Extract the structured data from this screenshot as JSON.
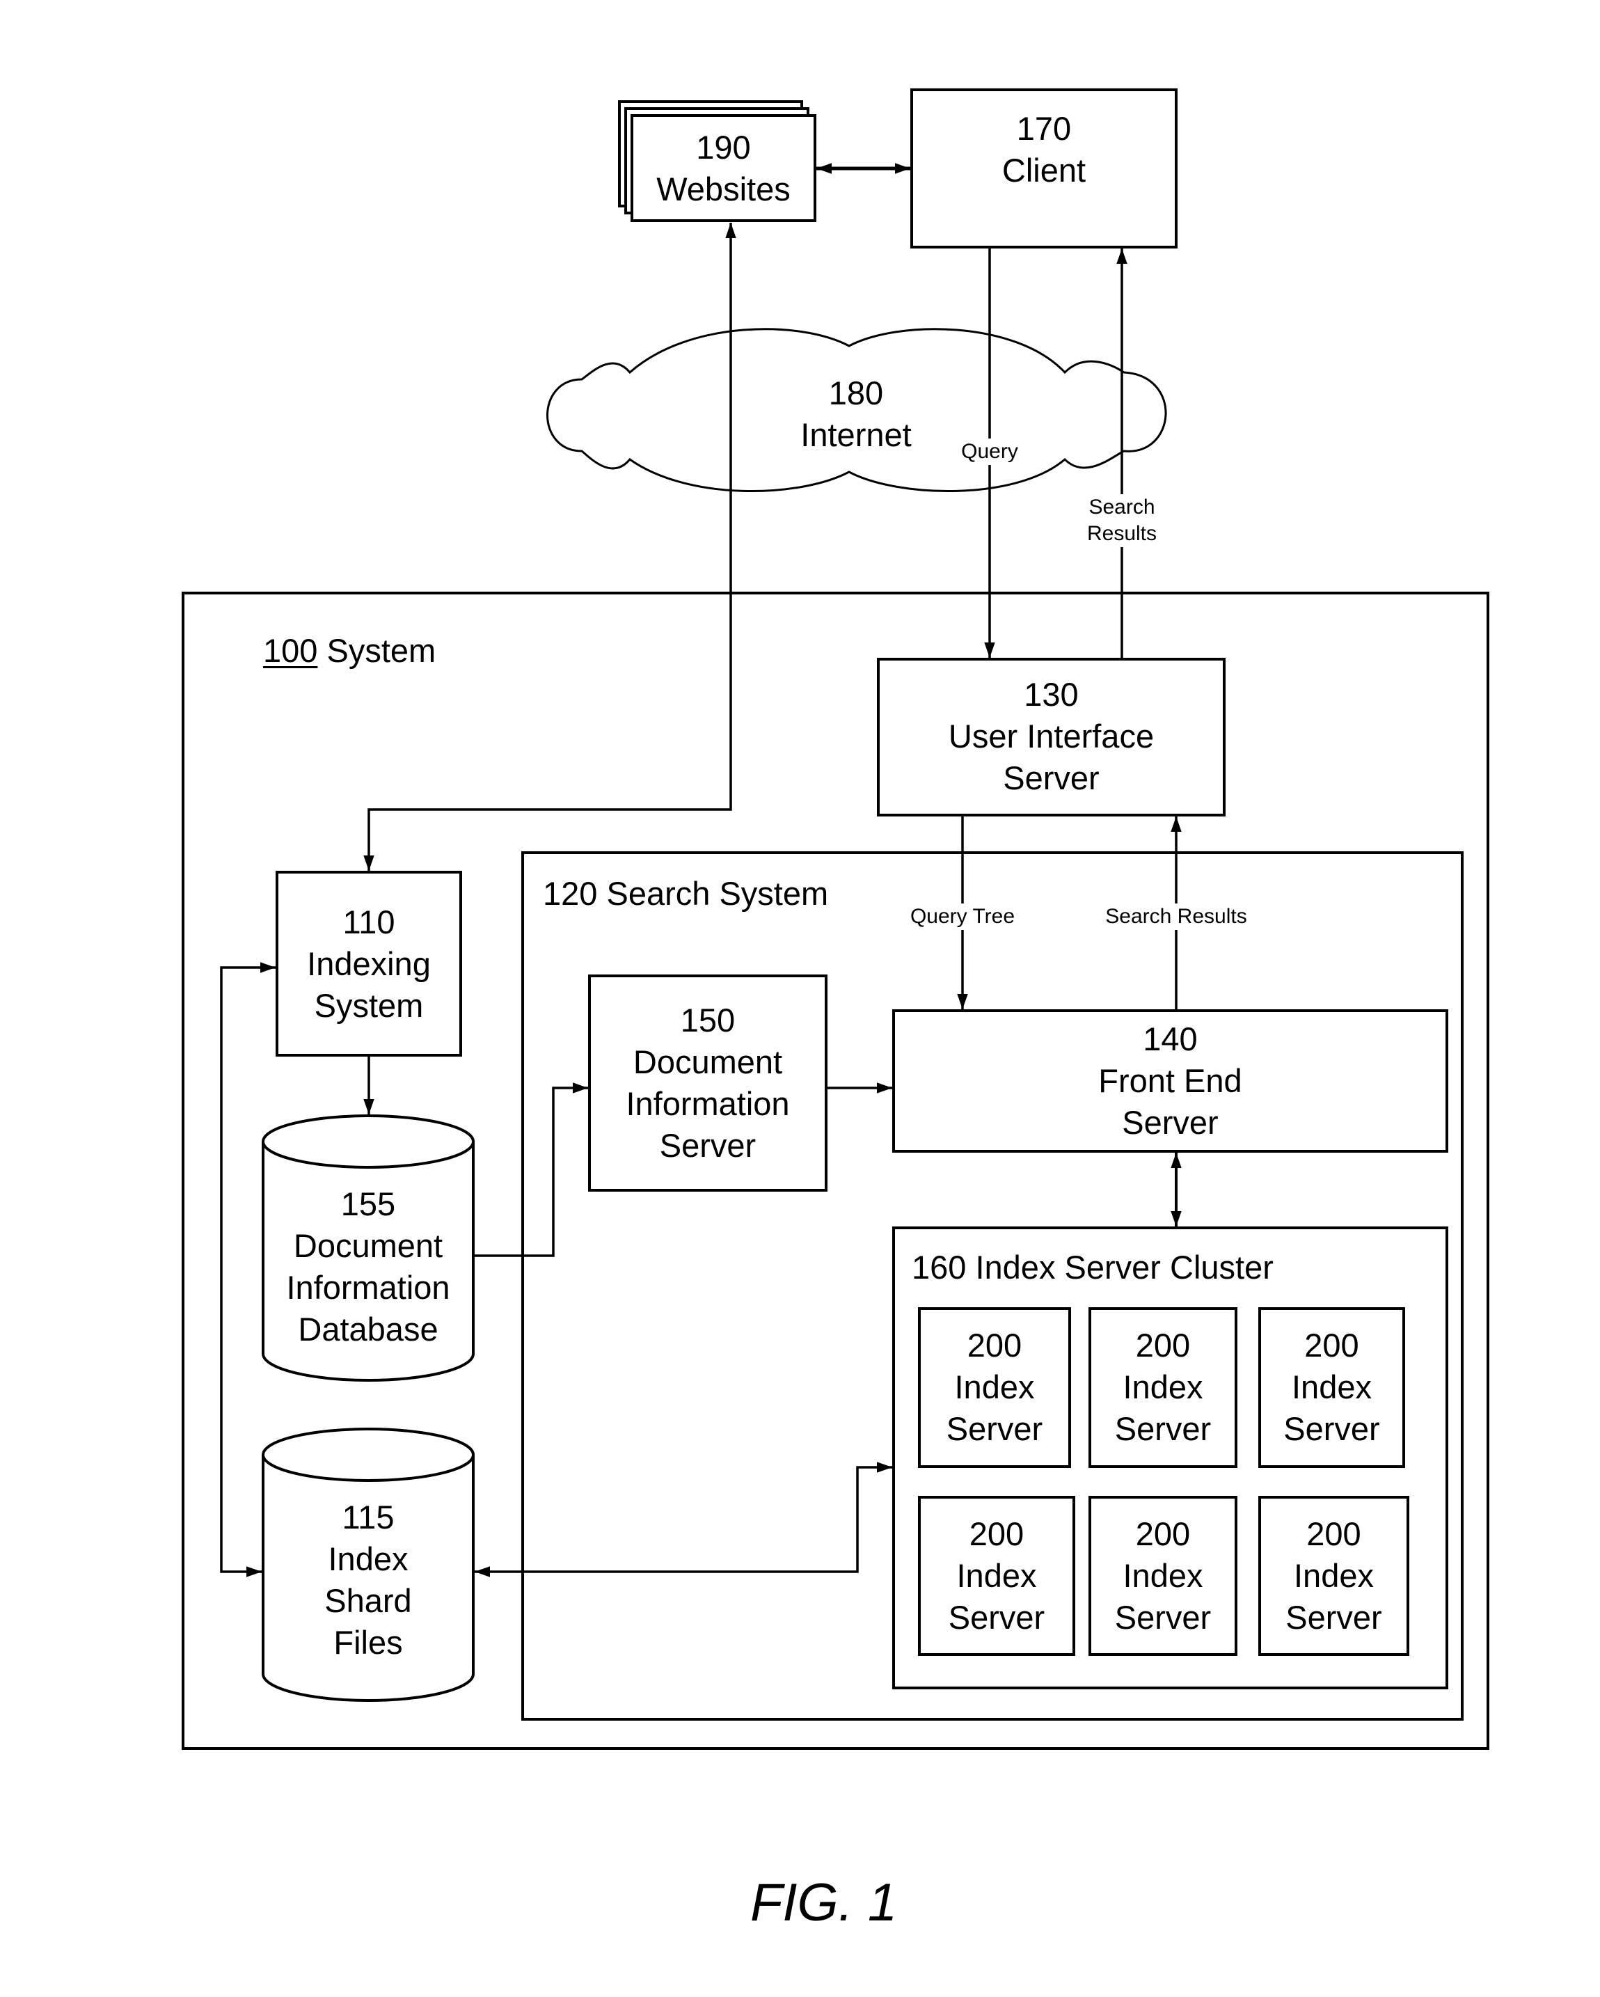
{
  "figure": {
    "caption": "FIG. 1",
    "external": {
      "websites": {
        "number": "190",
        "lines": [
          "Websites"
        ]
      },
      "client": {
        "number": "170",
        "lines": [
          "Client"
        ]
      },
      "internet": {
        "number": "180",
        "lines": [
          "Internet"
        ]
      }
    },
    "system": {
      "number": "100",
      "name": "System",
      "ui_server": {
        "number": "130",
        "lines": [
          "User Interface",
          "Server"
        ]
      },
      "indexing_system": {
        "number": "110",
        "lines": [
          "Indexing",
          "System"
        ]
      },
      "doc_info_db": {
        "number": "155",
        "lines": [
          "Document",
          "Information",
          "Database"
        ]
      },
      "index_shard_files": {
        "number": "115",
        "lines": [
          "Index",
          "Shard",
          "Files"
        ]
      },
      "search_system": {
        "title": "120 Search System",
        "doc_info_server": {
          "number": "150",
          "lines": [
            "Document",
            "Information",
            "Server"
          ]
        },
        "front_end_server": {
          "number": "140",
          "lines": [
            "Front End",
            "Server"
          ]
        },
        "index_cluster": {
          "title": "160 Index Server Cluster",
          "servers": [
            {
              "number": "200",
              "lines": [
                "Index",
                "Server"
              ]
            },
            {
              "number": "200",
              "lines": [
                "Index",
                "Server"
              ]
            },
            {
              "number": "200",
              "lines": [
                "Index",
                "Server"
              ]
            },
            {
              "number": "200",
              "lines": [
                "Index",
                "Server"
              ]
            },
            {
              "number": "200",
              "lines": [
                "Index",
                "Server"
              ]
            },
            {
              "number": "200",
              "lines": [
                "Index",
                "Server"
              ]
            }
          ]
        }
      }
    },
    "edge_labels": {
      "query": "Query",
      "search_results_top": [
        "Search",
        "Results"
      ],
      "query_tree": "Query Tree",
      "search_results_inner": "Search Results"
    }
  }
}
